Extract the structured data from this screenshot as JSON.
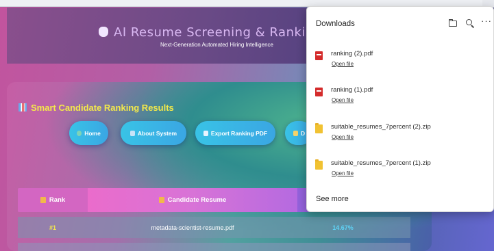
{
  "app": {
    "title": "AI Resume Screening & Ranking E",
    "subtitle": "Next-Generation Automated Hiring Intelligence"
  },
  "results": {
    "title": "Smart Candidate Ranking Results"
  },
  "nav": {
    "home": "Home",
    "about": "About System",
    "export": "Export Ranking PDF",
    "download": "D"
  },
  "table": {
    "headers": {
      "rank": "Rank",
      "resume": "Candidate Resume"
    },
    "rows": [
      {
        "rank": "#1",
        "file": "metadata-scientist-resume.pdf",
        "score": "14.67%"
      }
    ]
  },
  "downloads": {
    "title": "Downloads",
    "items": [
      {
        "name": "ranking (2).pdf",
        "action": "Open file",
        "type": "pdf"
      },
      {
        "name": "ranking (1).pdf",
        "action": "Open file",
        "type": "pdf"
      },
      {
        "name": "suitable_resumes_7percent (2).zip",
        "action": "Open file",
        "type": "zip"
      },
      {
        "name": "suitable_resumes_7percent (1).zip",
        "action": "Open file",
        "type": "zip"
      }
    ],
    "see_more": "See more",
    "more_glyph": "···"
  },
  "colors": {
    "title_yellow": "#f4e94a",
    "score_cyan": "#5fd3f6",
    "button_blue": "#39c3e6",
    "pdf_red": "#d42b2b",
    "zip_yellow": "#f1c232"
  }
}
